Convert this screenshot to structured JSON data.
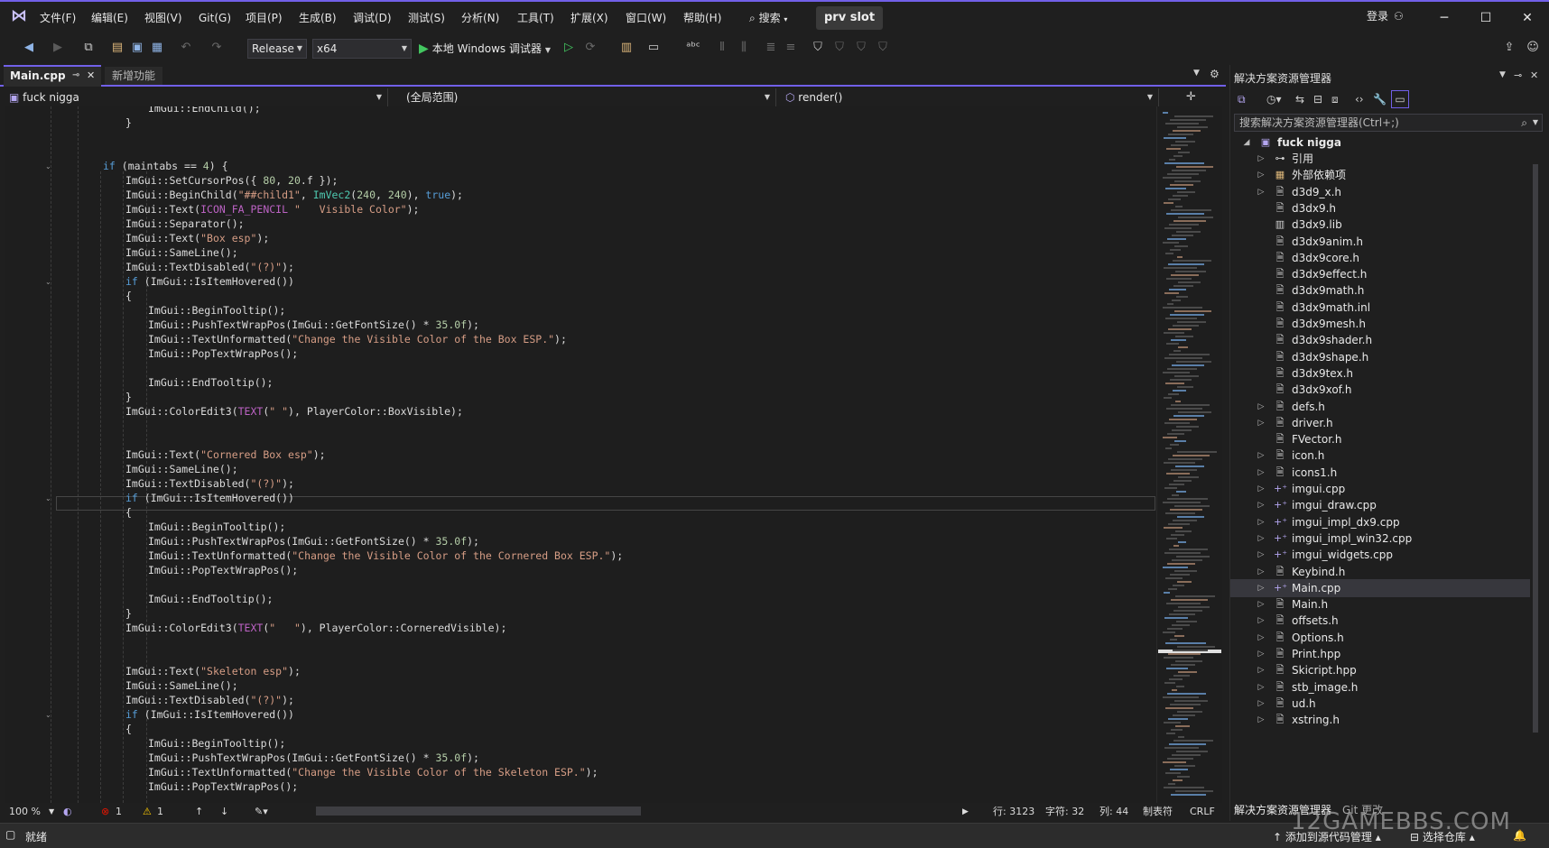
{
  "menu": [
    "文件(F)",
    "编辑(E)",
    "视图(V)",
    "Git(G)",
    "项目(P)",
    "生成(B)",
    "调试(D)",
    "测试(S)",
    "分析(N)",
    "工具(T)",
    "扩展(X)",
    "窗口(W)",
    "帮助(H)"
  ],
  "search_label": "搜索",
  "solution_name": "prv slot",
  "login_label": "登录",
  "toolbar": {
    "config": "Release",
    "platform": "x64",
    "run_label": "本地 Windows 调试器"
  },
  "tabs": {
    "active": "Main.cpp",
    "inactive": "新增功能"
  },
  "navbar": {
    "project": "fuck nigga",
    "scope": "(全局范围)",
    "member": "render()"
  },
  "editor": {
    "zoom": "100 %",
    "errors": "1",
    "warnings": "1",
    "line": "行: 3123",
    "char": "字符: 32",
    "col": "列: 44",
    "tabs": "制表符",
    "eol": "CRLF"
  },
  "code_lines": [
    "ImGui::EndChild();",
    "}",
    "",
    "",
    "if (maintabs == 4) {",
    "ImGui::SetCursorPos({ 80, 20.f });",
    "ImGui::BeginChild(\"##child1\", ImVec2(240, 240), true);",
    "ImGui::Text(ICON_FA_PENCIL \"   Visible Color\");",
    "ImGui::Separator();",
    "ImGui::Text(\"Box esp\");",
    "ImGui::SameLine();",
    "ImGui::TextDisabled(\"(?)\");",
    "if (ImGui::IsItemHovered())",
    "{",
    "ImGui::BeginTooltip();",
    "ImGui::PushTextWrapPos(ImGui::GetFontSize() * 35.0f);",
    "ImGui::TextUnformatted(\"Change the Visible Color of the Box ESP.\");",
    "ImGui::PopTextWrapPos();",
    "",
    "ImGui::EndTooltip();",
    "}",
    "ImGui::ColorEdit3(TEXT(\" \"), PlayerColor::BoxVisible);",
    "",
    "",
    "ImGui::Text(\"Cornered Box esp\");",
    "ImGui::SameLine();",
    "ImGui::TextDisabled(\"(?)\");",
    "if (ImGui::IsItemHovered())",
    "{",
    "ImGui::BeginTooltip();",
    "ImGui::PushTextWrapPos(ImGui::GetFontSize() * 35.0f);",
    "ImGui::TextUnformatted(\"Change the Visible Color of the Cornered Box ESP.\");",
    "ImGui::PopTextWrapPos();",
    "",
    "ImGui::EndTooltip();",
    "}",
    "ImGui::ColorEdit3(TEXT(\"   \"), PlayerColor::CorneredVisible);",
    "",
    "",
    "ImGui::Text(\"Skeleton esp\");",
    "ImGui::SameLine();",
    "ImGui::TextDisabled(\"(?)\");",
    "if (ImGui::IsItemHovered())",
    "{",
    "ImGui::BeginTooltip();",
    "ImGui::PushTextWrapPos(ImGui::GetFontSize() * 35.0f);",
    "ImGui::TextUnformatted(\"Change the Visible Color of the Skeleton ESP.\");",
    "ImGui::PopTextWrapPos();"
  ],
  "solution_explorer": {
    "title": "解决方案资源管理器",
    "search_placeholder": "搜索解决方案资源管理器(Ctrl+;)",
    "project": "fuck nigga",
    "items": [
      "引用",
      "外部依赖项",
      "d3d9_x.h",
      "d3dx9.h",
      "d3dx9.lib",
      "d3dx9anim.h",
      "d3dx9core.h",
      "d3dx9effect.h",
      "d3dx9math.h",
      "d3dx9math.inl",
      "d3dx9mesh.h",
      "d3dx9shader.h",
      "d3dx9shape.h",
      "d3dx9tex.h",
      "d3dx9xof.h",
      "defs.h",
      "driver.h",
      "FVector.h",
      "icon.h",
      "icons1.h",
      "imgui.cpp",
      "imgui_draw.cpp",
      "imgui_impl_dx9.cpp",
      "imgui_impl_win32.cpp",
      "imgui_widgets.cpp",
      "Keybind.h",
      "Main.cpp",
      "Main.h",
      "offsets.h",
      "Options.h",
      "Print.hpp",
      "Skicript.hpp",
      "stb_image.h",
      "ud.h",
      "xstring.h"
    ],
    "bottom_tabs": [
      "解决方案资源管理器",
      "Git 更改"
    ]
  },
  "statusbar": {
    "ready": "就绪",
    "add_source": "添加到源代码管理",
    "select_repo": "选择仓库"
  },
  "watermark": "12GAMEBBS.COM",
  "colors": {
    "accent": "#7160e8",
    "keyword": "#569cd6",
    "string": "#d69d85",
    "type": "#4ec9b0"
  }
}
